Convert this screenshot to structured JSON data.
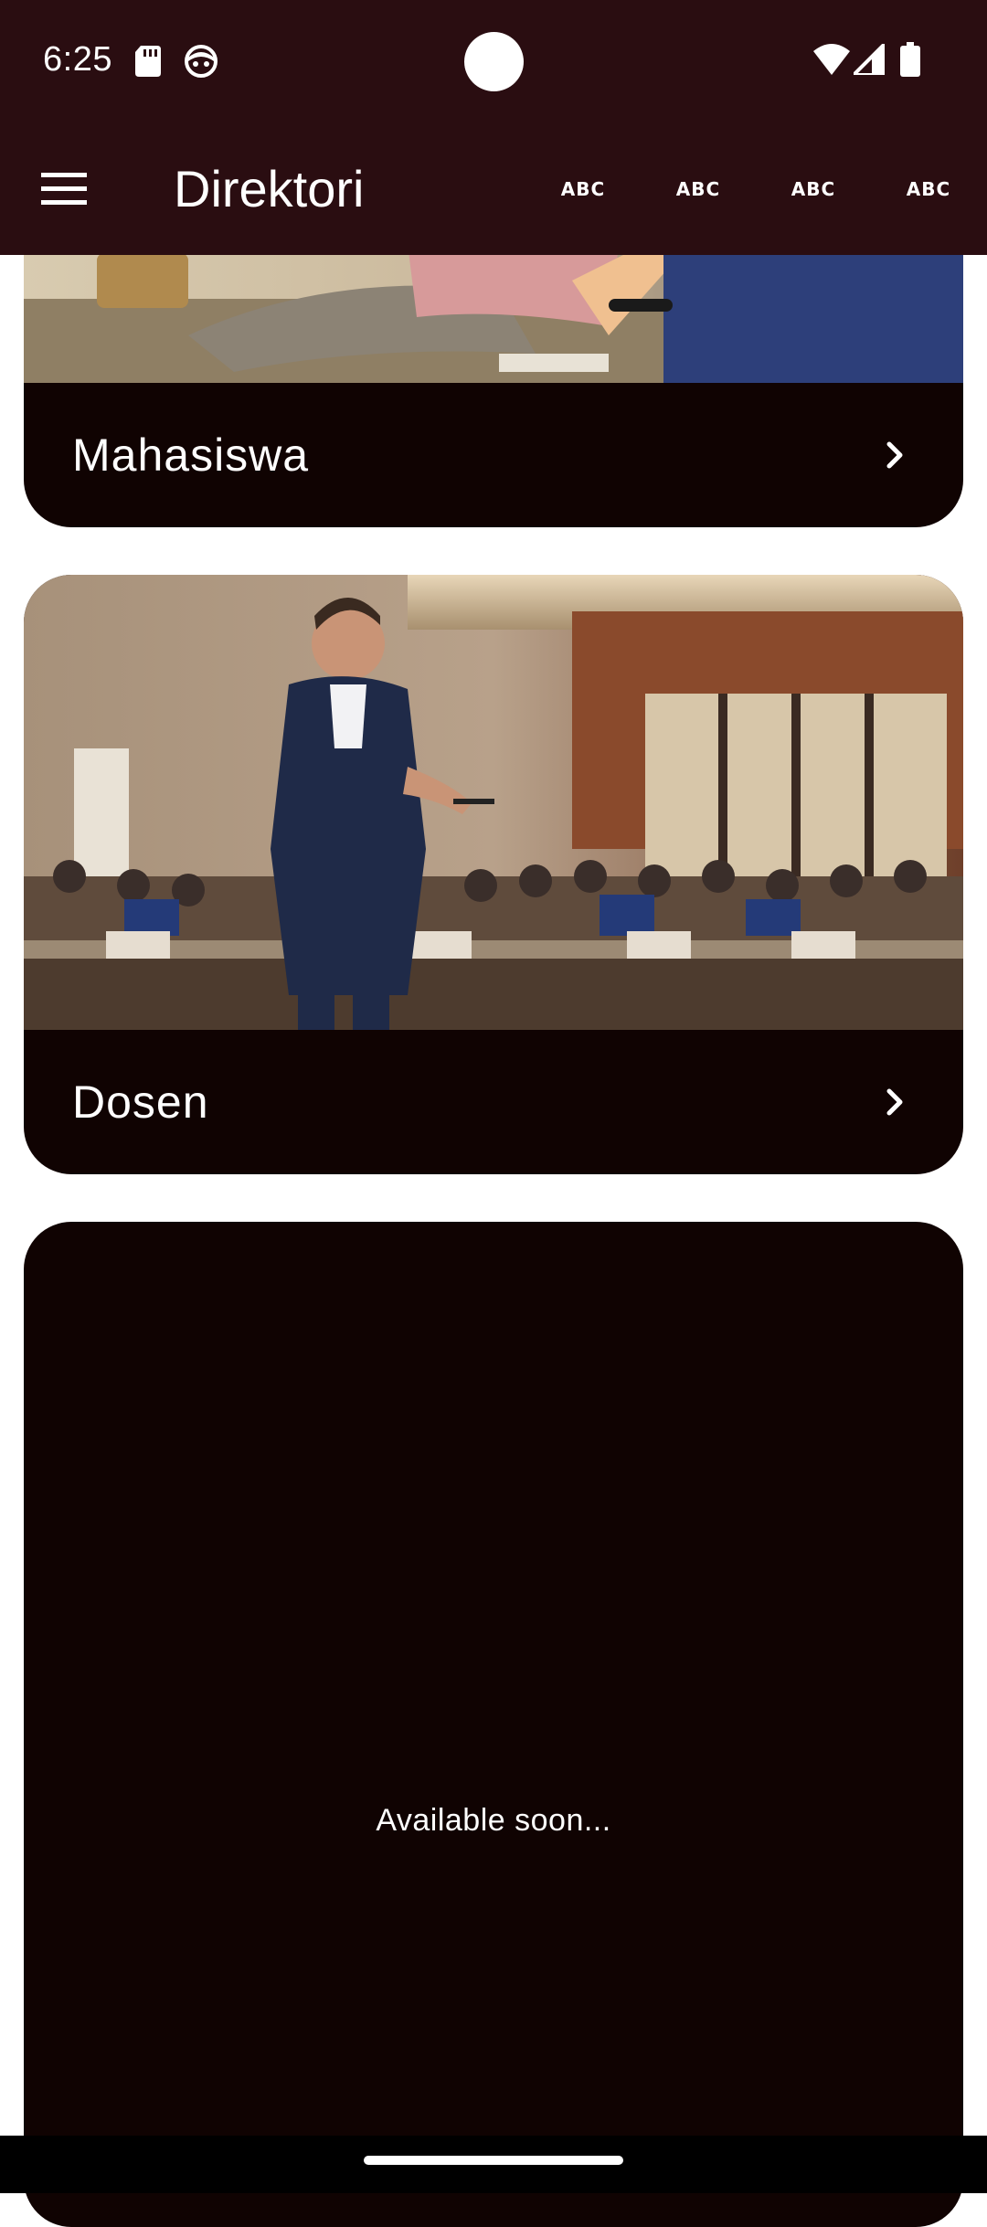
{
  "status_bar": {
    "time": "6:25",
    "icons": [
      "sd-card-icon",
      "face-icon",
      "wifi-icon",
      "cellular-signal-icon",
      "battery-icon"
    ]
  },
  "app_bar": {
    "menu_icon": "menu-icon",
    "title": "Direktori",
    "actions": [
      {
        "label": "ABC"
      },
      {
        "label": "ABC"
      },
      {
        "label": "ABC"
      },
      {
        "label": "ABC"
      }
    ]
  },
  "cards": [
    {
      "label": "Mahasiswa",
      "icon": "chevron-right-icon"
    },
    {
      "label": "Dosen",
      "icon": "chevron-right-icon"
    }
  ],
  "placeholder_card": {
    "message": "Available soon..."
  },
  "colors": {
    "app_bar_bg": "#2a0d11",
    "card_bg": "#100302",
    "text": "#ffffff"
  }
}
